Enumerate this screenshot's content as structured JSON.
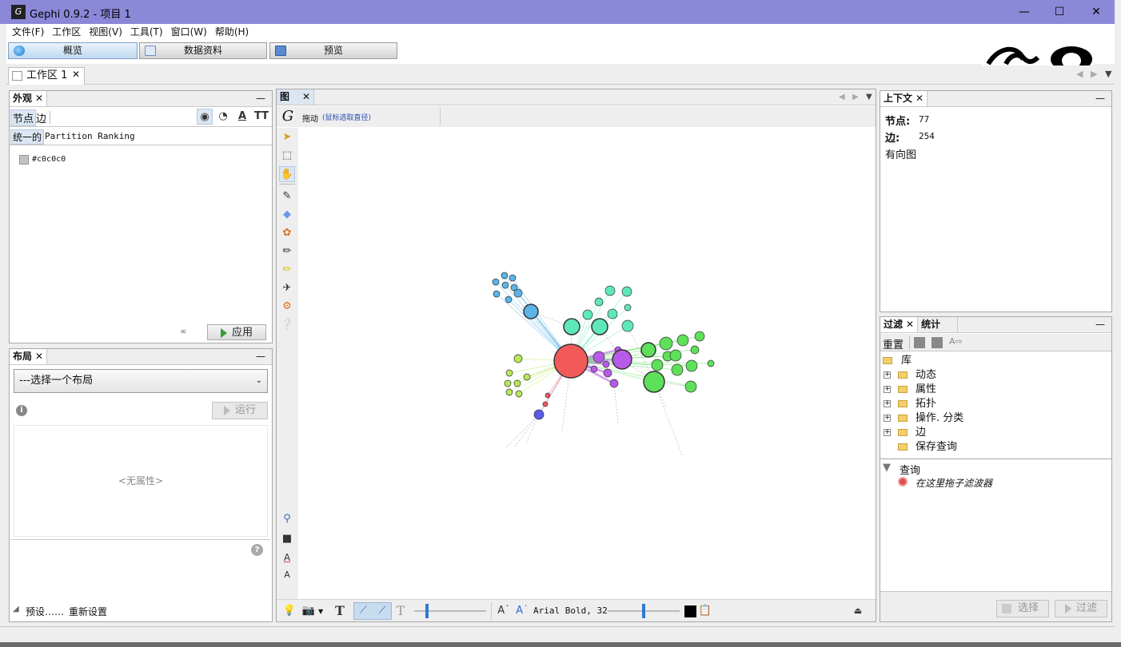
{
  "window": {
    "title": "Gephi 0.9.2 - 项目 1",
    "logo_text": "G",
    "minimize": "—",
    "maximize": "☐",
    "close": "✕"
  },
  "menu": [
    "文件(F)",
    "工作区",
    "视图(V)",
    "工具(T)",
    "窗口(W)",
    "帮助(H)"
  ],
  "modes": [
    {
      "label": "概览",
      "active": true
    },
    {
      "label": "数据资料",
      "active": false
    },
    {
      "label": "预览",
      "active": false
    }
  ],
  "workspace_tab": {
    "label": "工作区 1",
    "close": "✕"
  },
  "appearance": {
    "title": "外观",
    "tab_nodes": "节点",
    "tab_edges": "边",
    "sub_unique": "统一的",
    "sub_other": "Partition Ranking",
    "color_value": "#c0c0c0",
    "apply": "应用"
  },
  "layout": {
    "title": "布局",
    "select": "---选择一个布局",
    "run": "运行",
    "no_props": "<无属性>",
    "presets": "预设……",
    "reset": "重新设置"
  },
  "graph": {
    "title": "图",
    "drag_label": "拖动",
    "drag_hint": "(鼠标选取直径)",
    "font_label": "Arial Bold, 32"
  },
  "context": {
    "title": "上下文",
    "nodes_label": "节点:",
    "nodes_value": "77",
    "edges_label": "边:",
    "edges_value": "254",
    "graph_type": "有向图"
  },
  "filters": {
    "tab_filter": "过滤",
    "tab_stats": "统计",
    "reset": "重置",
    "library": "库",
    "items": [
      "动态",
      "属性",
      "拓扑",
      "操作. 分类",
      "边",
      "保存查询"
    ],
    "queries": "查询",
    "drop_hint": "在这里拖子滤波器",
    "select_btn": "选择",
    "filter_btn": "过滤"
  },
  "colors": {
    "titlebar": "#8c88d8",
    "node_red": "#f25a5a",
    "node_purple": "#b85ae8",
    "node_green": "#5ee05a",
    "node_teal": "#5ee8b8",
    "node_blue": "#5ab4e8",
    "node_yellowgreen": "#b8e85a",
    "node_darkblue": "#5a5ae8"
  }
}
